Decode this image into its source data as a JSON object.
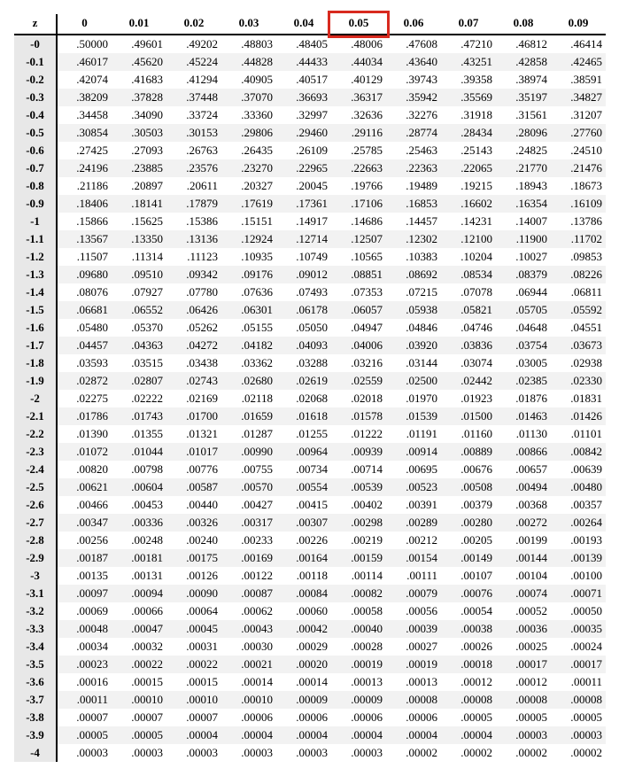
{
  "z_label": "z",
  "col_headers": [
    "0",
    "0.01",
    "0.02",
    "0.03",
    "0.04",
    "0.05",
    "0.06",
    "0.07",
    "0.08",
    "0.09"
  ],
  "highlight_col_index": 5,
  "rows": [
    {
      "z": "-0",
      "v": [
        ".50000",
        ".49601",
        ".49202",
        ".48803",
        ".48405",
        ".48006",
        ".47608",
        ".47210",
        ".46812",
        ".46414"
      ]
    },
    {
      "z": "-0.1",
      "v": [
        ".46017",
        ".45620",
        ".45224",
        ".44828",
        ".44433",
        ".44034",
        ".43640",
        ".43251",
        ".42858",
        ".42465"
      ]
    },
    {
      "z": "-0.2",
      "v": [
        ".42074",
        ".41683",
        ".41294",
        ".40905",
        ".40517",
        ".40129",
        ".39743",
        ".39358",
        ".38974",
        ".38591"
      ]
    },
    {
      "z": "-0.3",
      "v": [
        ".38209",
        ".37828",
        ".37448",
        ".37070",
        ".36693",
        ".36317",
        ".35942",
        ".35569",
        ".35197",
        ".34827"
      ]
    },
    {
      "z": "-0.4",
      "v": [
        ".34458",
        ".34090",
        ".33724",
        ".33360",
        ".32997",
        ".32636",
        ".32276",
        ".31918",
        ".31561",
        ".31207"
      ]
    },
    {
      "z": "-0.5",
      "v": [
        ".30854",
        ".30503",
        ".30153",
        ".29806",
        ".29460",
        ".29116",
        ".28774",
        ".28434",
        ".28096",
        ".27760"
      ]
    },
    {
      "z": "-0.6",
      "v": [
        ".27425",
        ".27093",
        ".26763",
        ".26435",
        ".26109",
        ".25785",
        ".25463",
        ".25143",
        ".24825",
        ".24510"
      ]
    },
    {
      "z": "-0.7",
      "v": [
        ".24196",
        ".23885",
        ".23576",
        ".23270",
        ".22965",
        ".22663",
        ".22363",
        ".22065",
        ".21770",
        ".21476"
      ]
    },
    {
      "z": "-0.8",
      "v": [
        ".21186",
        ".20897",
        ".20611",
        ".20327",
        ".20045",
        ".19766",
        ".19489",
        ".19215",
        ".18943",
        ".18673"
      ]
    },
    {
      "z": "-0.9",
      "v": [
        ".18406",
        ".18141",
        ".17879",
        ".17619",
        ".17361",
        ".17106",
        ".16853",
        ".16602",
        ".16354",
        ".16109"
      ]
    },
    {
      "z": "-1",
      "v": [
        ".15866",
        ".15625",
        ".15386",
        ".15151",
        ".14917",
        ".14686",
        ".14457",
        ".14231",
        ".14007",
        ".13786"
      ]
    },
    {
      "z": "-1.1",
      "v": [
        ".13567",
        ".13350",
        ".13136",
        ".12924",
        ".12714",
        ".12507",
        ".12302",
        ".12100",
        ".11900",
        ".11702"
      ]
    },
    {
      "z": "-1.2",
      "v": [
        ".11507",
        ".11314",
        ".11123",
        ".10935",
        ".10749",
        ".10565",
        ".10383",
        ".10204",
        ".10027",
        ".09853"
      ]
    },
    {
      "z": "-1.3",
      "v": [
        ".09680",
        ".09510",
        ".09342",
        ".09176",
        ".09012",
        ".08851",
        ".08692",
        ".08534",
        ".08379",
        ".08226"
      ]
    },
    {
      "z": "-1.4",
      "v": [
        ".08076",
        ".07927",
        ".07780",
        ".07636",
        ".07493",
        ".07353",
        ".07215",
        ".07078",
        ".06944",
        ".06811"
      ]
    },
    {
      "z": "-1.5",
      "v": [
        ".06681",
        ".06552",
        ".06426",
        ".06301",
        ".06178",
        ".06057",
        ".05938",
        ".05821",
        ".05705",
        ".05592"
      ]
    },
    {
      "z": "-1.6",
      "v": [
        ".05480",
        ".05370",
        ".05262",
        ".05155",
        ".05050",
        ".04947",
        ".04846",
        ".04746",
        ".04648",
        ".04551"
      ]
    },
    {
      "z": "-1.7",
      "v": [
        ".04457",
        ".04363",
        ".04272",
        ".04182",
        ".04093",
        ".04006",
        ".03920",
        ".03836",
        ".03754",
        ".03673"
      ]
    },
    {
      "z": "-1.8",
      "v": [
        ".03593",
        ".03515",
        ".03438",
        ".03362",
        ".03288",
        ".03216",
        ".03144",
        ".03074",
        ".03005",
        ".02938"
      ]
    },
    {
      "z": "-1.9",
      "v": [
        ".02872",
        ".02807",
        ".02743",
        ".02680",
        ".02619",
        ".02559",
        ".02500",
        ".02442",
        ".02385",
        ".02330"
      ]
    },
    {
      "z": "-2",
      "v": [
        ".02275",
        ".02222",
        ".02169",
        ".02118",
        ".02068",
        ".02018",
        ".01970",
        ".01923",
        ".01876",
        ".01831"
      ]
    },
    {
      "z": "-2.1",
      "v": [
        ".01786",
        ".01743",
        ".01700",
        ".01659",
        ".01618",
        ".01578",
        ".01539",
        ".01500",
        ".01463",
        ".01426"
      ]
    },
    {
      "z": "-2.2",
      "v": [
        ".01390",
        ".01355",
        ".01321",
        ".01287",
        ".01255",
        ".01222",
        ".01191",
        ".01160",
        ".01130",
        ".01101"
      ]
    },
    {
      "z": "-2.3",
      "v": [
        ".01072",
        ".01044",
        ".01017",
        ".00990",
        ".00964",
        ".00939",
        ".00914",
        ".00889",
        ".00866",
        ".00842"
      ]
    },
    {
      "z": "-2.4",
      "v": [
        ".00820",
        ".00798",
        ".00776",
        ".00755",
        ".00734",
        ".00714",
        ".00695",
        ".00676",
        ".00657",
        ".00639"
      ]
    },
    {
      "z": "-2.5",
      "v": [
        ".00621",
        ".00604",
        ".00587",
        ".00570",
        ".00554",
        ".00539",
        ".00523",
        ".00508",
        ".00494",
        ".00480"
      ]
    },
    {
      "z": "-2.6",
      "v": [
        ".00466",
        ".00453",
        ".00440",
        ".00427",
        ".00415",
        ".00402",
        ".00391",
        ".00379",
        ".00368",
        ".00357"
      ]
    },
    {
      "z": "-2.7",
      "v": [
        ".00347",
        ".00336",
        ".00326",
        ".00317",
        ".00307",
        ".00298",
        ".00289",
        ".00280",
        ".00272",
        ".00264"
      ]
    },
    {
      "z": "-2.8",
      "v": [
        ".00256",
        ".00248",
        ".00240",
        ".00233",
        ".00226",
        ".00219",
        ".00212",
        ".00205",
        ".00199",
        ".00193"
      ]
    },
    {
      "z": "-2.9",
      "v": [
        ".00187",
        ".00181",
        ".00175",
        ".00169",
        ".00164",
        ".00159",
        ".00154",
        ".00149",
        ".00144",
        ".00139"
      ]
    },
    {
      "z": "-3",
      "v": [
        ".00135",
        ".00131",
        ".00126",
        ".00122",
        ".00118",
        ".00114",
        ".00111",
        ".00107",
        ".00104",
        ".00100"
      ]
    },
    {
      "z": "-3.1",
      "v": [
        ".00097",
        ".00094",
        ".00090",
        ".00087",
        ".00084",
        ".00082",
        ".00079",
        ".00076",
        ".00074",
        ".00071"
      ]
    },
    {
      "z": "-3.2",
      "v": [
        ".00069",
        ".00066",
        ".00064",
        ".00062",
        ".00060",
        ".00058",
        ".00056",
        ".00054",
        ".00052",
        ".00050"
      ]
    },
    {
      "z": "-3.3",
      "v": [
        ".00048",
        ".00047",
        ".00045",
        ".00043",
        ".00042",
        ".00040",
        ".00039",
        ".00038",
        ".00036",
        ".00035"
      ]
    },
    {
      "z": "-3.4",
      "v": [
        ".00034",
        ".00032",
        ".00031",
        ".00030",
        ".00029",
        ".00028",
        ".00027",
        ".00026",
        ".00025",
        ".00024"
      ]
    },
    {
      "z": "-3.5",
      "v": [
        ".00023",
        ".00022",
        ".00022",
        ".00021",
        ".00020",
        ".00019",
        ".00019",
        ".00018",
        ".00017",
        ".00017"
      ]
    },
    {
      "z": "-3.6",
      "v": [
        ".00016",
        ".00015",
        ".00015",
        ".00014",
        ".00014",
        ".00013",
        ".00013",
        ".00012",
        ".00012",
        ".00011"
      ]
    },
    {
      "z": "-3.7",
      "v": [
        ".00011",
        ".00010",
        ".00010",
        ".00010",
        ".00009",
        ".00009",
        ".00008",
        ".00008",
        ".00008",
        ".00008"
      ]
    },
    {
      "z": "-3.8",
      "v": [
        ".00007",
        ".00007",
        ".00007",
        ".00006",
        ".00006",
        ".00006",
        ".00006",
        ".00005",
        ".00005",
        ".00005"
      ]
    },
    {
      "z": "-3.9",
      "v": [
        ".00005",
        ".00005",
        ".00004",
        ".00004",
        ".00004",
        ".00004",
        ".00004",
        ".00004",
        ".00003",
        ".00003"
      ]
    },
    {
      "z": "-4",
      "v": [
        ".00003",
        ".00003",
        ".00003",
        ".00003",
        ".00003",
        ".00003",
        ".00002",
        ".00002",
        ".00002",
        ".00002"
      ]
    }
  ]
}
